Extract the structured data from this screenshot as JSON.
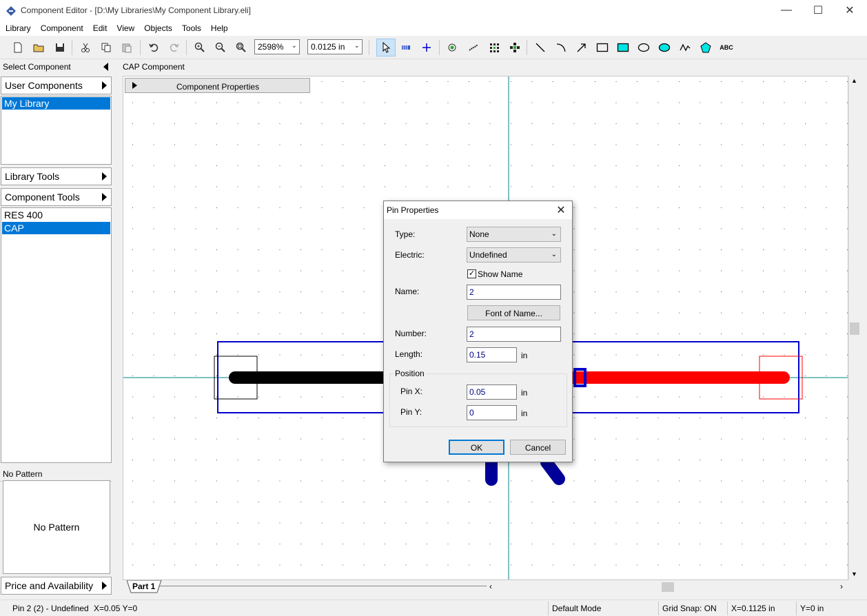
{
  "window": {
    "title": "Component Editor - [D:\\My Libraries\\My Component Library.eli]",
    "minimize": "—",
    "maximize": "☐",
    "close": "✕"
  },
  "menu": [
    "Library",
    "Component",
    "Edit",
    "View",
    "Objects",
    "Tools",
    "Help"
  ],
  "toolbar": {
    "zoom": "2598%",
    "grid": "0.0125 in"
  },
  "left": {
    "header": "Select Component",
    "user_components": "User Components",
    "libraries": [
      "My Library"
    ],
    "library_tools": "Library Tools",
    "component_tools": "Component Tools",
    "components": [
      "RES 400",
      "CAP"
    ],
    "pattern_header": "No Pattern",
    "pattern_preview": "No Pattern",
    "price": "Price and Availability"
  },
  "canvas": {
    "label": "CAP Component",
    "properties_tab": "Component Properties",
    "part_tab": "Part 1"
  },
  "dialog": {
    "title": "Pin Properties",
    "type_label": "Type:",
    "type_value": "None",
    "electric_label": "Electric:",
    "electric_value": "Undefined",
    "show_name": "Show Name",
    "show_name_checked": true,
    "name_label": "Name:",
    "name_value": "2",
    "font_button": "Font of Name...",
    "number_label": "Number:",
    "number_value": "2",
    "length_label": "Length:",
    "length_value": "0.15",
    "unit": "in",
    "position_group": "Position",
    "pinx_label": "Pin X:",
    "pinx_value": "0.05",
    "piny_label": "Pin Y:",
    "piny_value": "0",
    "ok": "OK",
    "cancel": "Cancel"
  },
  "status": {
    "pin": "Pin 2 (2) - Undefined",
    "xy": "X=0.05  Y=0",
    "mode": "Default Mode",
    "snap": "Grid Snap: ON",
    "cx": "X=0.1125 in",
    "cy": "Y=0 in"
  },
  "colors": {
    "selection": "#0078d7",
    "pin_selected": "#ff0000",
    "body_outline": "#0000cc",
    "pin_normal": "#000000"
  }
}
